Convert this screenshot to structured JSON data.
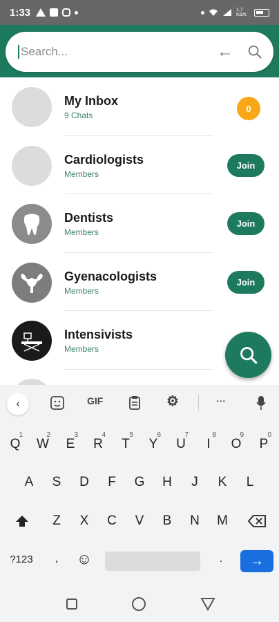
{
  "status_bar": {
    "time": "1:33",
    "icons": [
      "warning-icon",
      "image-icon",
      "instagram-icon",
      "dot-icon",
      "wifi-icon",
      "signal-icon",
      "battery-icon"
    ],
    "data_speed": "1.7 KB/s"
  },
  "search": {
    "placeholder": "Search..."
  },
  "list": [
    {
      "title": "My Inbox",
      "subtitle": "9 Chats",
      "badge": "0",
      "avatar": "blank"
    },
    {
      "title": "Cardiologists",
      "subtitle": "Members",
      "action": "Join",
      "avatar": "blank"
    },
    {
      "title": "Dentists",
      "subtitle": "Members",
      "action": "Join",
      "avatar": "tooth-icon"
    },
    {
      "title": "Gyenacologists",
      "subtitle": "Members",
      "action": "Join",
      "avatar": "uterus-icon"
    },
    {
      "title": "Intensivists",
      "subtitle": "Members",
      "action": "",
      "avatar": "icu-bed-icon"
    }
  ],
  "keyboard": {
    "toolbar": {
      "gif": "GIF",
      "more": "···"
    },
    "row1": [
      "Q",
      "W",
      "E",
      "R",
      "T",
      "Y",
      "U",
      "I",
      "O",
      "P"
    ],
    "row1_hints": [
      "1",
      "2",
      "3",
      "4",
      "5",
      "6",
      "7",
      "8",
      "9",
      "0"
    ],
    "row2": [
      "A",
      "S",
      "D",
      "F",
      "G",
      "H",
      "J",
      "K",
      "L"
    ],
    "row3": [
      "Z",
      "X",
      "C",
      "V",
      "B",
      "N",
      "M"
    ],
    "symbols": "?123",
    "comma": ",",
    "period": "."
  }
}
